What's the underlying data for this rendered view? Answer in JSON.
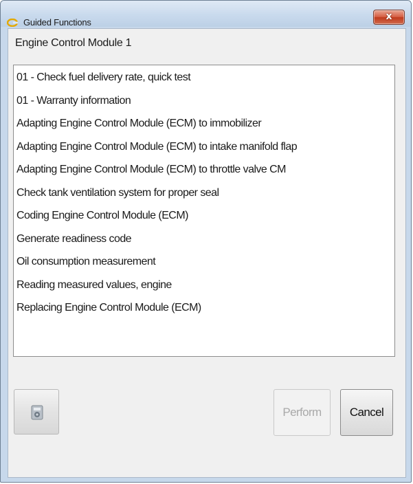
{
  "window": {
    "title": "Guided Functions",
    "close_label": "x"
  },
  "module": {
    "title": "Engine Control Module 1"
  },
  "functions": [
    "01 - Check fuel delivery rate, quick test",
    "01 - Warranty information",
    "Adapting Engine Control Module (ECM) to immobilizer",
    "Adapting Engine Control Module (ECM) to intake manifold flap",
    "Adapting Engine Control Module (ECM) to throttle valve CM",
    "Check tank ventilation system for proper seal",
    "Coding Engine Control Module (ECM)",
    "Generate readiness code",
    "Oil consumption measurement",
    "Reading measured values, engine",
    "Replacing Engine Control Module (ECM)"
  ],
  "buttons": {
    "perform_label": "Perform",
    "cancel_label": "Cancel",
    "device_icon": "device-icon"
  },
  "colors": {
    "window_frame": "#c7d8eb",
    "close_button": "#d65f44",
    "app_icon": "#f0b400",
    "disabled_text": "#a9a9a9"
  }
}
